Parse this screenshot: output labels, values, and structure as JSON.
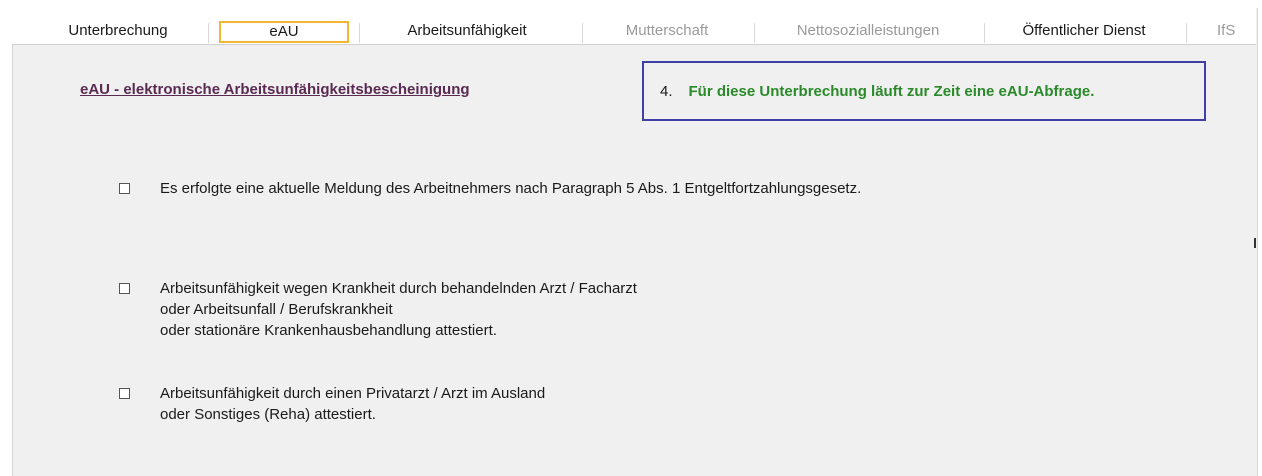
{
  "tabs": [
    {
      "label": "Unterbrechung",
      "state": "normal"
    },
    {
      "label": "eAU",
      "state": "active"
    },
    {
      "label": "Arbeitsunfähigkeit",
      "state": "normal"
    },
    {
      "label": "Mutterschaft",
      "state": "disabled"
    },
    {
      "label": "Nettosozialleistungen",
      "state": "disabled"
    },
    {
      "label": "Öffentlicher Dienst",
      "state": "normal"
    },
    {
      "label": "IfS",
      "state": "disabled"
    }
  ],
  "section": {
    "title": "eAU - elektronische Arbeitsunfähigkeitsbescheinigung"
  },
  "notice": {
    "number": "4.",
    "message": "Für diese Unterbrechung läuft zur Zeit eine eAU-Abfrage.",
    "message_color": "#2a8a2a",
    "border_color": "#3f3fa6"
  },
  "options": [
    {
      "checked": false,
      "lines": [
        "Es erfolgte eine aktuelle Meldung des Arbeitnehmers nach Paragraph 5 Abs. 1 Entgeltfortzahlungsgesetz."
      ]
    },
    {
      "checked": false,
      "lines": [
        "Arbeitsunfähigkeit wegen Krankheit durch behandelnden Arzt / Facharzt",
        "oder Arbeitsunfall / Berufskrankheit",
        "oder stationäre Krankenhausbehandlung attestiert."
      ]
    },
    {
      "checked": false,
      "lines": [
        "Arbeitsunfähigkeit durch einen Privatarzt / Arzt im Ausland",
        "oder Sonstiges (Reha) attestiert."
      ]
    }
  ],
  "colors": {
    "active_tab_border": "#f2b632",
    "title_color": "#5a2a52"
  }
}
